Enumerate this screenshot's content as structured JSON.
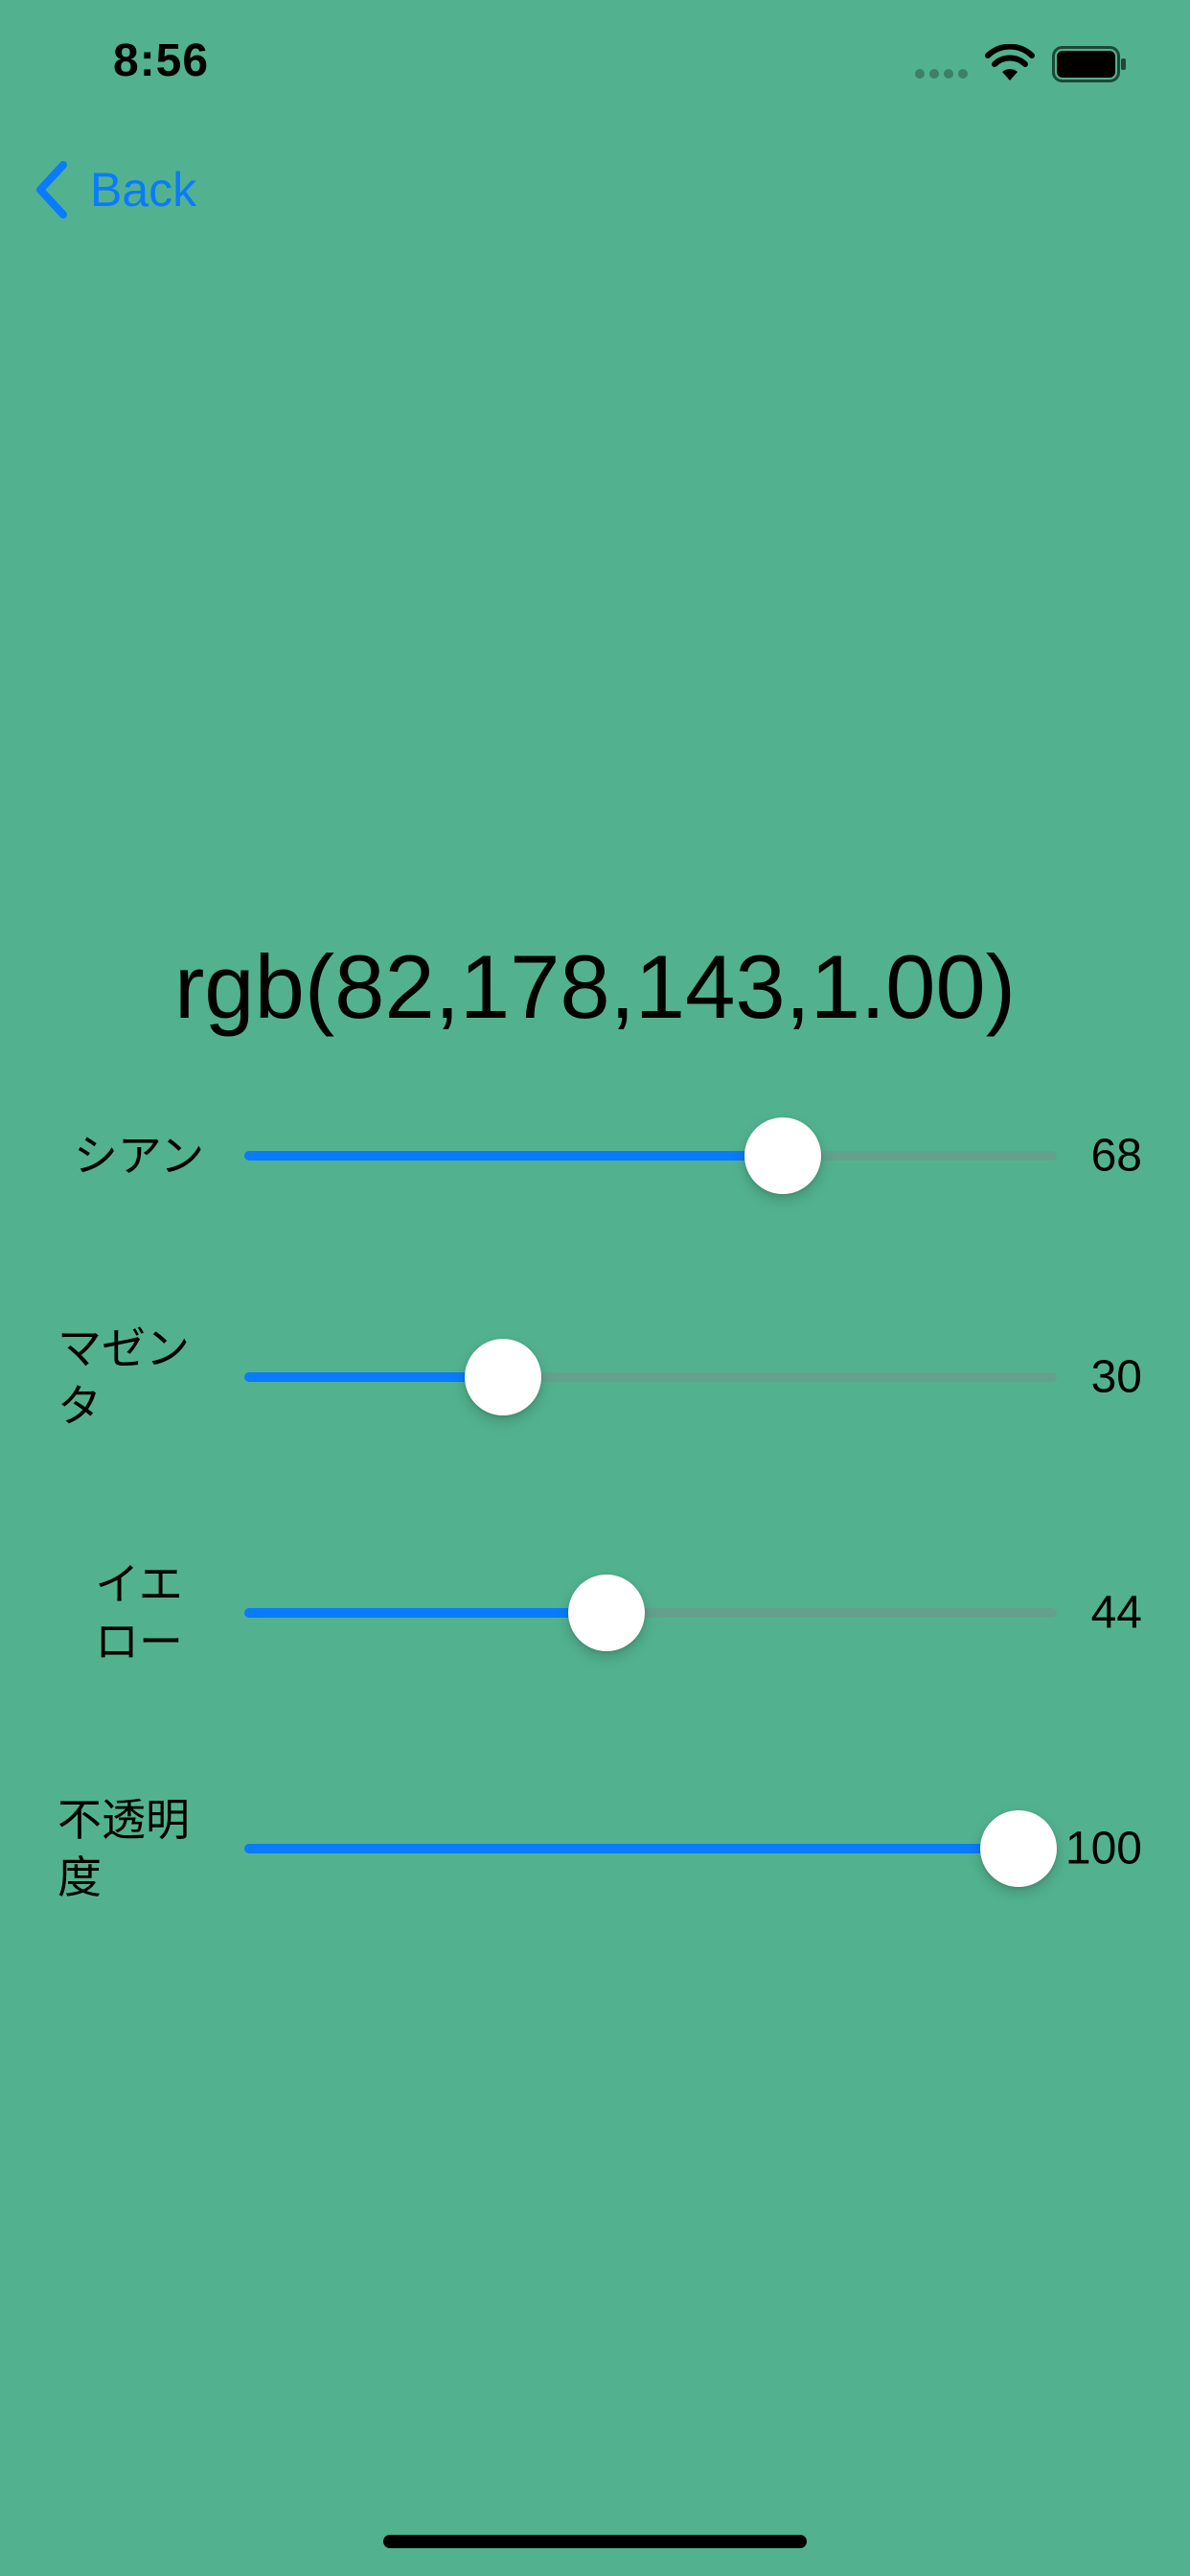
{
  "status_bar": {
    "time": "8:56",
    "icons": [
      "cellular-signal-icon",
      "wifi-icon",
      "battery-icon"
    ]
  },
  "nav": {
    "back_label": "Back",
    "back_icon": "chevron-left-icon",
    "accent_color": "#0A7AFF"
  },
  "color_display": {
    "value": "rgb(82,178,143,1.00)",
    "background": "#52B28F"
  },
  "sliders": [
    {
      "label": "シアン",
      "value": "68",
      "fraction": 0.68
    },
    {
      "label": "マゼン\nタ",
      "value": "30",
      "fraction": 0.3
    },
    {
      "label": "イエ\nロー",
      "value": "44",
      "fraction": 0.44
    },
    {
      "label": "不透明\n度",
      "value": "100",
      "fraction": 1.0
    }
  ]
}
